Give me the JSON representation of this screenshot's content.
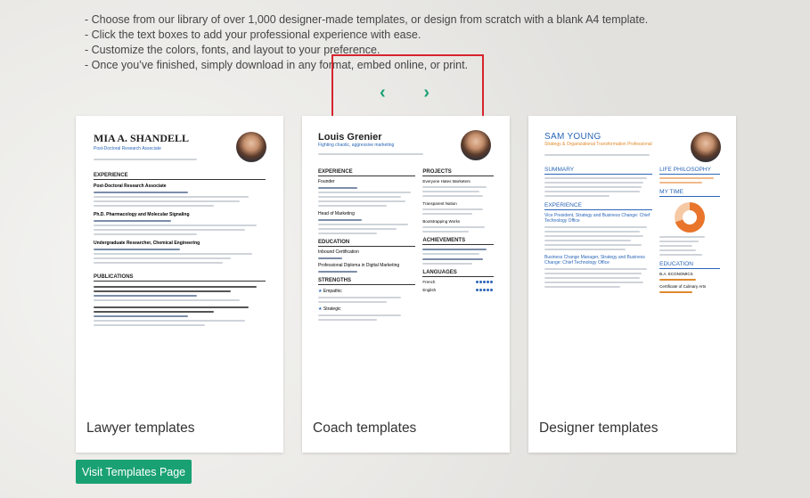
{
  "bullets": [
    "Choose from our library of over 1,000 designer-made templates, or design from scratch with a blank A4 template.",
    "Click the text boxes to add your professional experience with ease.",
    "Customize the colors, fonts, and layout to your preference.",
    "Once you’ve finished, simply download in any format, embed online, or print."
  ],
  "carousel": {
    "prev_icon": "chevron-left-icon",
    "next_icon": "chevron-right-icon",
    "prev_glyph": "‹",
    "next_glyph": "›"
  },
  "colors": {
    "accent": "#1aa173",
    "highlight": "#d6242d",
    "resume_blue": "#2a66b8"
  },
  "cards": [
    {
      "label": "Lawyer templates",
      "resume": {
        "name": "MIA A. SHANDELL",
        "subtitle": "Post-Doctoral Research Associate",
        "sections": [
          "EXPERIENCE",
          "PUBLICATIONS"
        ],
        "jobs": [
          "Post-Doctoral Research Associate",
          "Ph.D. Pharmacology and Molecular Signaling",
          "Undergraduate Researcher, Chemical Engineering"
        ]
      }
    },
    {
      "label": "Coach templates",
      "resume": {
        "name": "Louis Grenier",
        "subtitle": "Fighting chaotic, aggressive marketing",
        "left_sections": [
          "EXPERIENCE",
          "EDUCATION",
          "STRENGTHS"
        ],
        "right_sections": [
          "PROJECTS",
          "ACHIEVEMENTS",
          "LANGUAGES"
        ],
        "jobs": [
          "Founder",
          "Head of Marketing",
          "Inbound Certification",
          "Professional Diploma in Digital Marketing"
        ],
        "strengths": [
          "Empathic",
          "Strategic"
        ],
        "projects": [
          "Everyone Hates Marketers",
          "Transparent Nation",
          "Bootstrapping Works"
        ],
        "languages": [
          "French",
          "English"
        ]
      }
    },
    {
      "label": "Designer templates",
      "resume": {
        "name": "SAM YOUNG",
        "subtitle": "Strategy & Organizational Transformation Professional",
        "left_sections": [
          "SUMMARY",
          "EXPERIENCE"
        ],
        "right_sections": [
          "LIFE PHILOSOPHY",
          "MY TIME",
          "EDUCATION"
        ],
        "jobs": [
          "Vice President, Strategy and Business Change: Chief Technology Office",
          "Business Change Manager, Strategy and Business Change: Chief Technology Office"
        ],
        "education": [
          "B.A. ECONOMICS",
          "Certificate of Culinary Arts"
        ]
      }
    }
  ],
  "visit_button": "Visit Templates Page"
}
